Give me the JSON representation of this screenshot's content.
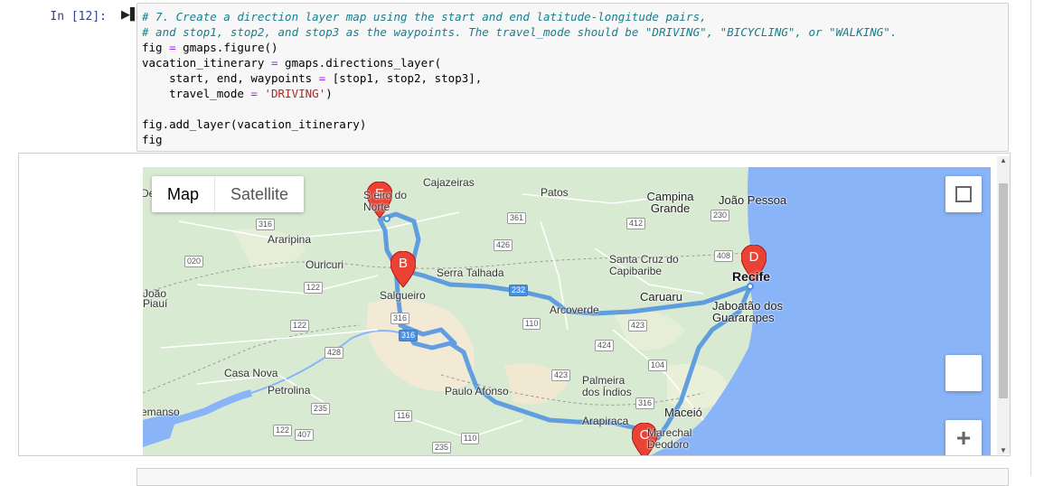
{
  "cell": {
    "prompt": "In [12]:",
    "code_lines": [
      {
        "type": "comment",
        "text": "# 7. Create a direction layer map using the start and end latitude-longitude pairs,"
      },
      {
        "type": "comment",
        "text": "# and stop1, stop2, and stop3 as the waypoints. The travel_mode should be \"DRIVING\", \"BICYCLING\", or \"WALKING\"."
      },
      {
        "type": "code",
        "text": "fig = gmaps.figure()"
      },
      {
        "type": "code",
        "text": "vacation_itinerary = gmaps.directions_layer("
      },
      {
        "type": "code",
        "text": "    start, end, waypoints = [stop1, stop2, stop3],"
      },
      {
        "type": "code",
        "text": "    travel_mode = 'DRIVING')"
      },
      {
        "type": "code",
        "text": ""
      },
      {
        "type": "code",
        "text": "fig.add_layer(vacation_itinerary)"
      },
      {
        "type": "code",
        "text": "fig"
      }
    ]
  },
  "map": {
    "map_type_buttons": [
      "Map",
      "Satellite"
    ],
    "active_map_type": "Map",
    "zoom_in_label": "+",
    "markers": [
      {
        "label": "E"
      },
      {
        "label": "B"
      },
      {
        "label": "D"
      },
      {
        "label": "C"
      }
    ],
    "places": [
      {
        "name": "De"
      },
      {
        "name": "Cajazeiras"
      },
      {
        "name": "Patos"
      },
      {
        "name": "Campina Grande"
      },
      {
        "name": "João Pessoa"
      },
      {
        "name": "Sousa do Norte",
        "shown": "S eiro do Norte"
      },
      {
        "name": "Araripina"
      },
      {
        "name": "Ouricuri"
      },
      {
        "name": "Serra Talhada"
      },
      {
        "name": "Santa Cruz do Capibaribe"
      },
      {
        "name": "Recife"
      },
      {
        "name": "João Piauí"
      },
      {
        "name": "Salgueiro"
      },
      {
        "name": "Caruaru"
      },
      {
        "name": "Arcoverde"
      },
      {
        "name": "Jaboatão dos Guararapes"
      },
      {
        "name": "Casa Nova"
      },
      {
        "name": "Petrolina"
      },
      {
        "name": "Paulo Afonso"
      },
      {
        "name": "Palmeira dos Índios"
      },
      {
        "name": "Maceió"
      },
      {
        "name": "Arapiraca"
      },
      {
        "name": "Marechal Deodoro"
      },
      {
        "name": "emanso"
      }
    ],
    "road_shields": [
      "316",
      "361",
      "426",
      "412",
      "230",
      "408",
      "020",
      "122",
      "232",
      "122",
      "110",
      "316",
      "428",
      "316",
      "423",
      "424",
      "104",
      "423",
      "316",
      "235",
      "116",
      "122",
      "407",
      "110",
      "235"
    ],
    "colors": {
      "land": "#d8ead5",
      "ocean": "#8fb4f5",
      "route": "#4a90e2",
      "marker": "#ea4335"
    }
  }
}
